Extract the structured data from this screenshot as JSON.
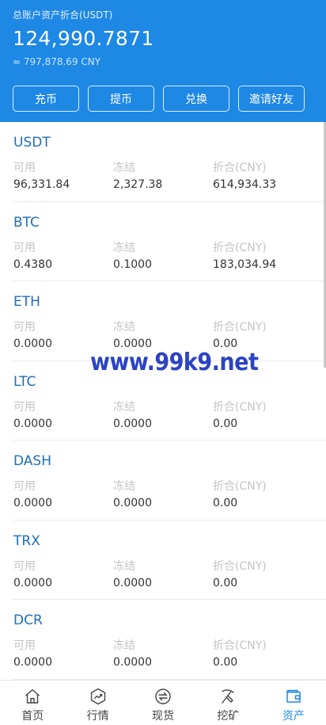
{
  "header": {
    "label": "总账户资产折合(USDT)",
    "total": "124,990.7871",
    "cny": "≈ 797,878.69 CNY",
    "background": "#1e88e5"
  },
  "actions": [
    {
      "label": "充币"
    },
    {
      "label": "提币"
    },
    {
      "label": "兑换"
    },
    {
      "label": "邀请好友"
    }
  ],
  "columns": {
    "available": "可用",
    "frozen": "冻结",
    "cny": "折合(CNY)"
  },
  "assets": [
    {
      "name": "USDT",
      "available": "96,331.84",
      "frozen": "2,327.38",
      "cny": "614,934.33"
    },
    {
      "name": "BTC",
      "available": "0.4380",
      "frozen": "0.1000",
      "cny": "183,034.94"
    },
    {
      "name": "ETH",
      "available": "0.0000",
      "frozen": "0.0000",
      "cny": "0.00"
    },
    {
      "name": "LTC",
      "available": "0.0000",
      "frozen": "0.0000",
      "cny": "0.00"
    },
    {
      "name": "DASH",
      "available": "0.0000",
      "frozen": "0.0000",
      "cny": "0.00"
    },
    {
      "name": "TRX",
      "available": "0.0000",
      "frozen": "0.0000",
      "cny": "0.00"
    },
    {
      "name": "DCR",
      "available": "0.0000",
      "frozen": "0.0000",
      "cny": "0.00"
    }
  ],
  "watermark": "www.99k9.net",
  "tabs": [
    {
      "label": "首页",
      "icon": "home-icon",
      "active": false
    },
    {
      "label": "行情",
      "icon": "market-icon",
      "active": false
    },
    {
      "label": "现货",
      "icon": "spot-icon",
      "active": false
    },
    {
      "label": "挖矿",
      "icon": "mining-icon",
      "active": false
    },
    {
      "label": "资产",
      "icon": "wallet-icon",
      "active": true
    }
  ],
  "colors": {
    "accent": "#1e88e5",
    "asset_name": "#1f6db8",
    "watermark": "#2b43c4"
  }
}
